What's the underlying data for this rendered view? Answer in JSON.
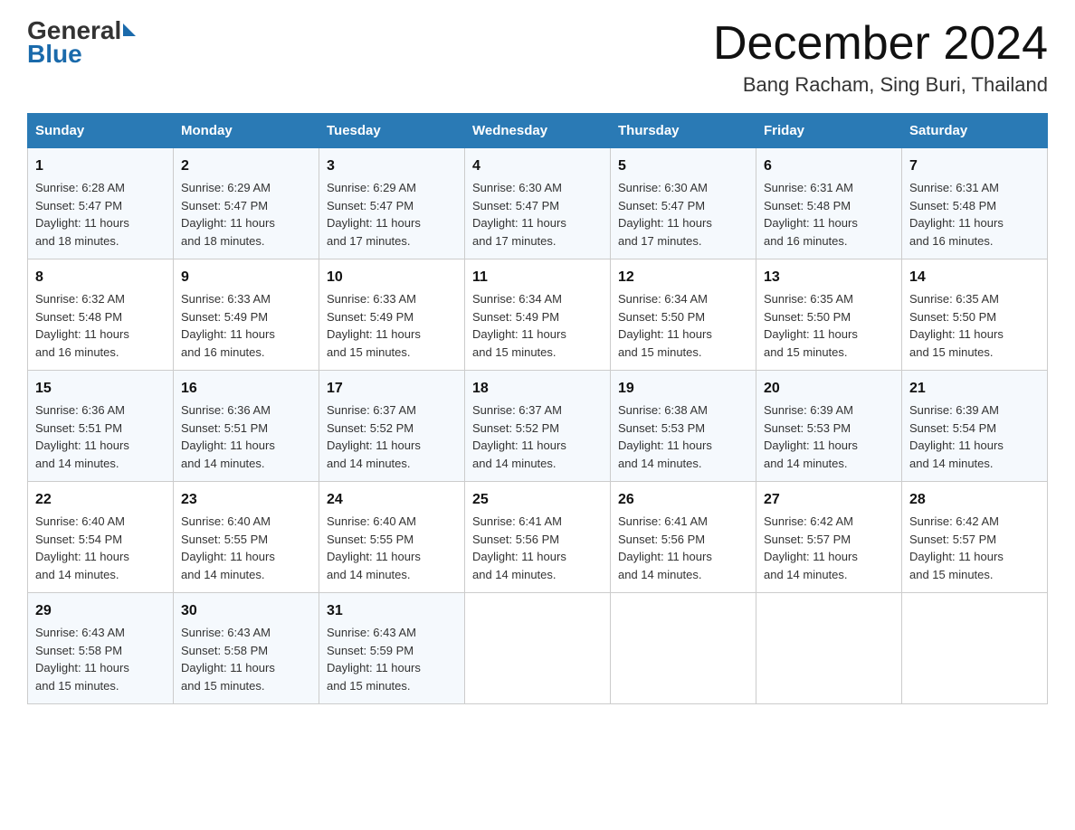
{
  "header": {
    "logo_general": "General",
    "logo_blue": "Blue",
    "month_title": "December 2024",
    "location": "Bang Racham, Sing Buri, Thailand"
  },
  "days_of_week": [
    "Sunday",
    "Monday",
    "Tuesday",
    "Wednesday",
    "Thursday",
    "Friday",
    "Saturday"
  ],
  "weeks": [
    [
      {
        "day": "1",
        "sunrise": "6:28 AM",
        "sunset": "5:47 PM",
        "daylight": "11 hours and 18 minutes."
      },
      {
        "day": "2",
        "sunrise": "6:29 AM",
        "sunset": "5:47 PM",
        "daylight": "11 hours and 18 minutes."
      },
      {
        "day": "3",
        "sunrise": "6:29 AM",
        "sunset": "5:47 PM",
        "daylight": "11 hours and 17 minutes."
      },
      {
        "day": "4",
        "sunrise": "6:30 AM",
        "sunset": "5:47 PM",
        "daylight": "11 hours and 17 minutes."
      },
      {
        "day": "5",
        "sunrise": "6:30 AM",
        "sunset": "5:47 PM",
        "daylight": "11 hours and 17 minutes."
      },
      {
        "day": "6",
        "sunrise": "6:31 AM",
        "sunset": "5:48 PM",
        "daylight": "11 hours and 16 minutes."
      },
      {
        "day": "7",
        "sunrise": "6:31 AM",
        "sunset": "5:48 PM",
        "daylight": "11 hours and 16 minutes."
      }
    ],
    [
      {
        "day": "8",
        "sunrise": "6:32 AM",
        "sunset": "5:48 PM",
        "daylight": "11 hours and 16 minutes."
      },
      {
        "day": "9",
        "sunrise": "6:33 AM",
        "sunset": "5:49 PM",
        "daylight": "11 hours and 16 minutes."
      },
      {
        "day": "10",
        "sunrise": "6:33 AM",
        "sunset": "5:49 PM",
        "daylight": "11 hours and 15 minutes."
      },
      {
        "day": "11",
        "sunrise": "6:34 AM",
        "sunset": "5:49 PM",
        "daylight": "11 hours and 15 minutes."
      },
      {
        "day": "12",
        "sunrise": "6:34 AM",
        "sunset": "5:50 PM",
        "daylight": "11 hours and 15 minutes."
      },
      {
        "day": "13",
        "sunrise": "6:35 AM",
        "sunset": "5:50 PM",
        "daylight": "11 hours and 15 minutes."
      },
      {
        "day": "14",
        "sunrise": "6:35 AM",
        "sunset": "5:50 PM",
        "daylight": "11 hours and 15 minutes."
      }
    ],
    [
      {
        "day": "15",
        "sunrise": "6:36 AM",
        "sunset": "5:51 PM",
        "daylight": "11 hours and 14 minutes."
      },
      {
        "day": "16",
        "sunrise": "6:36 AM",
        "sunset": "5:51 PM",
        "daylight": "11 hours and 14 minutes."
      },
      {
        "day": "17",
        "sunrise": "6:37 AM",
        "sunset": "5:52 PM",
        "daylight": "11 hours and 14 minutes."
      },
      {
        "day": "18",
        "sunrise": "6:37 AM",
        "sunset": "5:52 PM",
        "daylight": "11 hours and 14 minutes."
      },
      {
        "day": "19",
        "sunrise": "6:38 AM",
        "sunset": "5:53 PM",
        "daylight": "11 hours and 14 minutes."
      },
      {
        "day": "20",
        "sunrise": "6:39 AM",
        "sunset": "5:53 PM",
        "daylight": "11 hours and 14 minutes."
      },
      {
        "day": "21",
        "sunrise": "6:39 AM",
        "sunset": "5:54 PM",
        "daylight": "11 hours and 14 minutes."
      }
    ],
    [
      {
        "day": "22",
        "sunrise": "6:40 AM",
        "sunset": "5:54 PM",
        "daylight": "11 hours and 14 minutes."
      },
      {
        "day": "23",
        "sunrise": "6:40 AM",
        "sunset": "5:55 PM",
        "daylight": "11 hours and 14 minutes."
      },
      {
        "day": "24",
        "sunrise": "6:40 AM",
        "sunset": "5:55 PM",
        "daylight": "11 hours and 14 minutes."
      },
      {
        "day": "25",
        "sunrise": "6:41 AM",
        "sunset": "5:56 PM",
        "daylight": "11 hours and 14 minutes."
      },
      {
        "day": "26",
        "sunrise": "6:41 AM",
        "sunset": "5:56 PM",
        "daylight": "11 hours and 14 minutes."
      },
      {
        "day": "27",
        "sunrise": "6:42 AM",
        "sunset": "5:57 PM",
        "daylight": "11 hours and 14 minutes."
      },
      {
        "day": "28",
        "sunrise": "6:42 AM",
        "sunset": "5:57 PM",
        "daylight": "11 hours and 15 minutes."
      }
    ],
    [
      {
        "day": "29",
        "sunrise": "6:43 AM",
        "sunset": "5:58 PM",
        "daylight": "11 hours and 15 minutes."
      },
      {
        "day": "30",
        "sunrise": "6:43 AM",
        "sunset": "5:58 PM",
        "daylight": "11 hours and 15 minutes."
      },
      {
        "day": "31",
        "sunrise": "6:43 AM",
        "sunset": "5:59 PM",
        "daylight": "11 hours and 15 minutes."
      },
      null,
      null,
      null,
      null
    ]
  ],
  "labels": {
    "sunrise": "Sunrise:",
    "sunset": "Sunset:",
    "daylight": "Daylight:"
  }
}
